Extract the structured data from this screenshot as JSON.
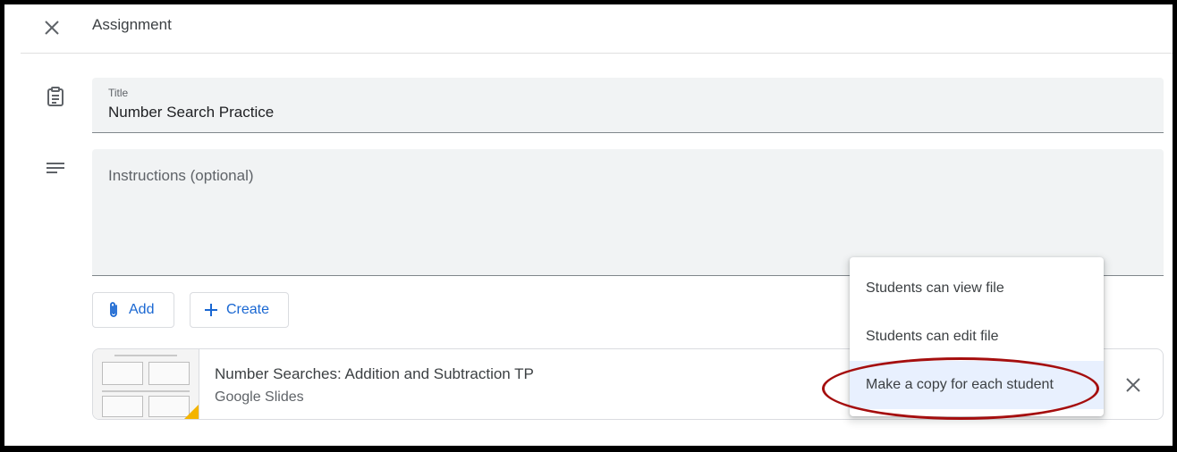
{
  "header": {
    "title": "Assignment",
    "close_icon": "close-icon"
  },
  "title_field": {
    "label": "Title",
    "value": "Number Search Practice",
    "icon": "assignment-clipboard-icon"
  },
  "instructions": {
    "placeholder": "Instructions (optional)",
    "value": "",
    "icon": "notes-lines-icon"
  },
  "actions": {
    "add_label": "Add",
    "add_icon": "paperclip-icon",
    "create_label": "Create",
    "create_icon": "plus-icon"
  },
  "attachment": {
    "title": "Number Searches: Addition and Subtraction TP",
    "type": "Google Slides",
    "remove_icon": "close-icon",
    "thumbnail_accent_color": "#f4b400"
  },
  "share_menu": {
    "items": [
      {
        "label": "Students can view file"
      },
      {
        "label": "Students can edit file"
      },
      {
        "label": "Make a copy for each student"
      }
    ],
    "selected_index": 2,
    "selected_bg_color": "#e8f0fe",
    "annotation_color": "#a50e0e"
  },
  "colors": {
    "accent": "#1967d2",
    "field_bg": "#f1f3f4"
  }
}
